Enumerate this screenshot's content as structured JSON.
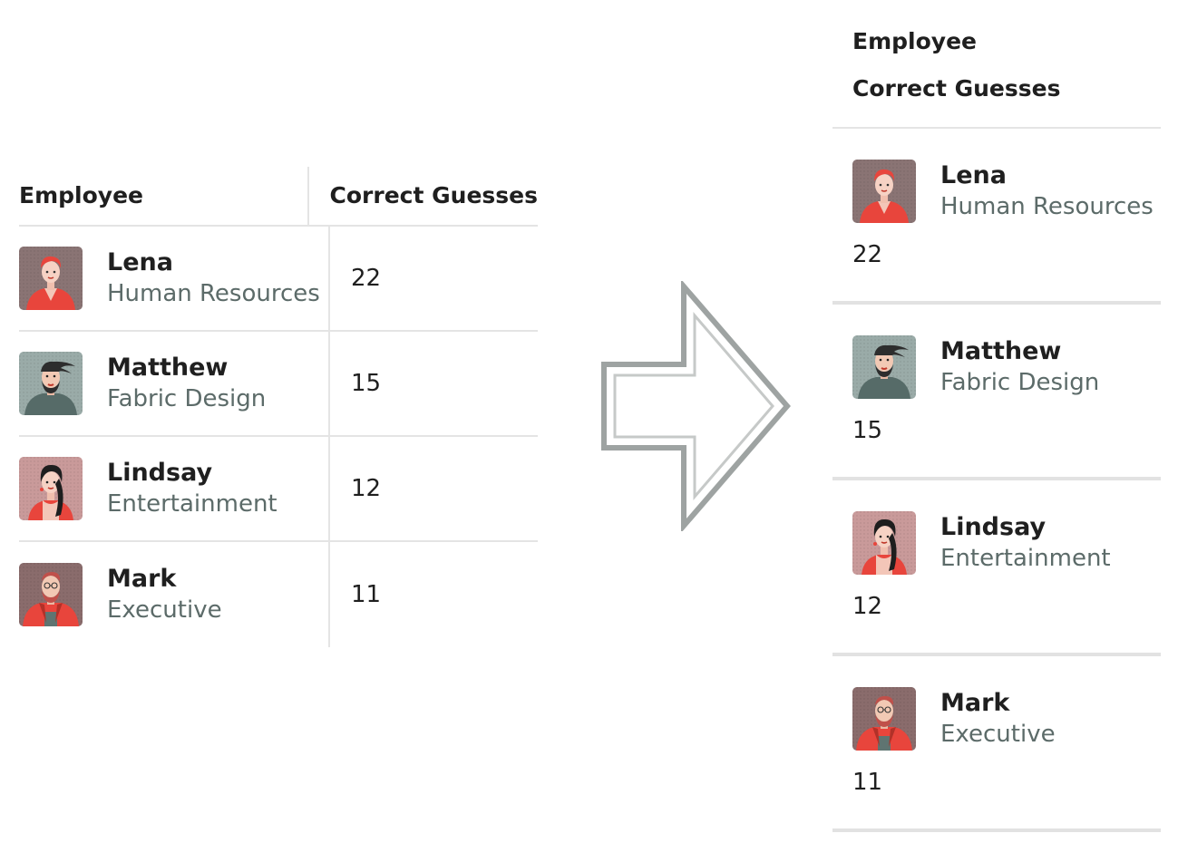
{
  "table": {
    "header_employee": "Employee",
    "header_score": "Correct Guesses"
  },
  "stacked": {
    "header_employee": "Employee",
    "header_score": "Correct Guesses"
  },
  "employees": [
    {
      "name": "Lena",
      "department": "Human Resources",
      "score": "22",
      "avatar": "lena-avatar"
    },
    {
      "name": "Matthew",
      "department": "Fabric Design",
      "score": "15",
      "avatar": "matthew-avatar"
    },
    {
      "name": "Lindsay",
      "department": "Entertainment",
      "score": "12",
      "avatar": "lindsay-avatar"
    },
    {
      "name": "Mark",
      "department": "Executive",
      "score": "11",
      "avatar": "mark-avatar"
    }
  ],
  "icons": {
    "transition": "right-arrow-icon"
  },
  "colors": {
    "text": "#1f1f1f",
    "department_text": "#5c6b69",
    "divider": "#e4e4e4",
    "arrow_stroke": "#9ea3a2",
    "lena_bg": "#8a7474",
    "matthew_bg": "#9aaba8",
    "lindsay_bg": "#c99a9a",
    "mark_bg": "#8a6c6c"
  }
}
